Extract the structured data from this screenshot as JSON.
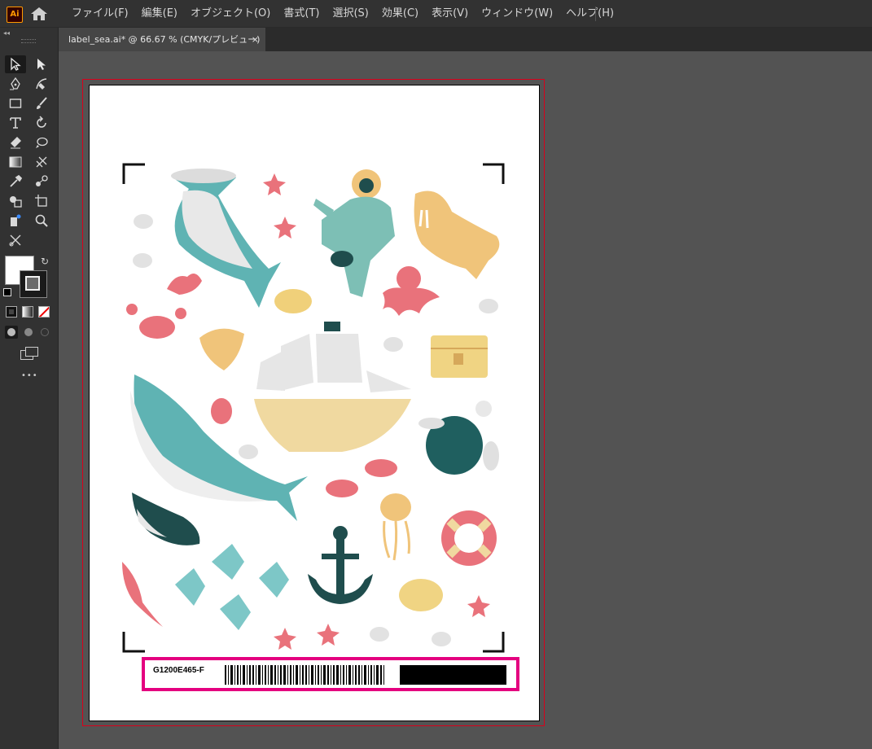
{
  "app": {
    "logo_text": "Ai"
  },
  "menu": [
    "ファイル(F)",
    "編集(E)",
    "オブジェクト(O)",
    "書式(T)",
    "選択(S)",
    "効果(C)",
    "表示(V)",
    "ウィンドウ(W)",
    "ヘルプ(H)"
  ],
  "document": {
    "tab_title": "label_sea.ai* @ 66.67 % (CMYK/プレビュー)",
    "close_glyph": "×"
  },
  "toolbar": {
    "more_glyph": "•••",
    "collapse_glyph": "◂◂"
  },
  "label": {
    "code": "G1200E465-F"
  },
  "colors": {
    "bleed": "#d9001b",
    "label_border": "#e4007f",
    "teal": "#5fb3b3",
    "coral": "#e9727b",
    "sand": "#f0c47a",
    "dark_teal": "#1f4d4d"
  }
}
